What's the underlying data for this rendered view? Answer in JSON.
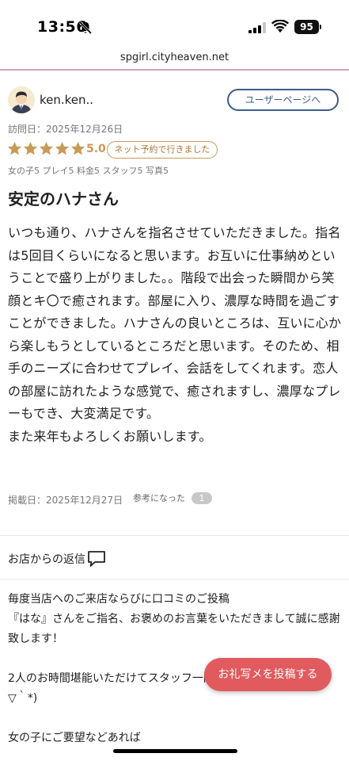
{
  "status_bar": {
    "time": "13:56",
    "battery": "95"
  },
  "browser": {
    "url": "spgirl.cityheaven.net"
  },
  "reviewer": {
    "name": "ken.ken..",
    "user_page_button": "ユーザーページへ",
    "visit_date": "訪問日：2025年12月26日"
  },
  "rating": {
    "stars": 5,
    "score": "5.0",
    "badge": "ネット予約で行きました",
    "sub_scores": "女の子5 プレイ5 料金5 スタッフ5 写真5",
    "star_color": "#c89a55"
  },
  "review": {
    "title": "安定のハナさん",
    "body": "いつも通り、ハナさんを指名させていただきました。指名は5回目くらいになると思います。お互いに仕事納めということで盛り上がりました。。階段で出会った瞬間から笑顔とキ〇で癒されます。部屋に入り、濃厚な時間を過ごすことができました。ハナさんの良いところは、互いに心から楽しもうとしているところだと思います。そのため、相手のニーズに合わせてプレイ、会話をしてくれます。恋人の部屋に訪れたような感覚で、癒されますし、濃厚なプレーもでき、大変満足です。\nまた来年もよろしくお願いします。",
    "posted_date": "掲載日：2025年12月27日",
    "helpful_label": "参考になった",
    "helpful_count": "1"
  },
  "shop_reply": {
    "header": "お店からの返信",
    "body": "毎度当店へのご来店ならびに口コミのご投稿\n『はな』さんをご指名、お褒めのお言葉をいただきまして誠に感謝致します！\n\n2人のお時間堪能いただけてスタッフ一同(\n▽｀*)\n\n女の子にご要望などあれば"
  },
  "fab": {
    "label": "お礼写メを投稿する",
    "color": "#e15a5e"
  }
}
